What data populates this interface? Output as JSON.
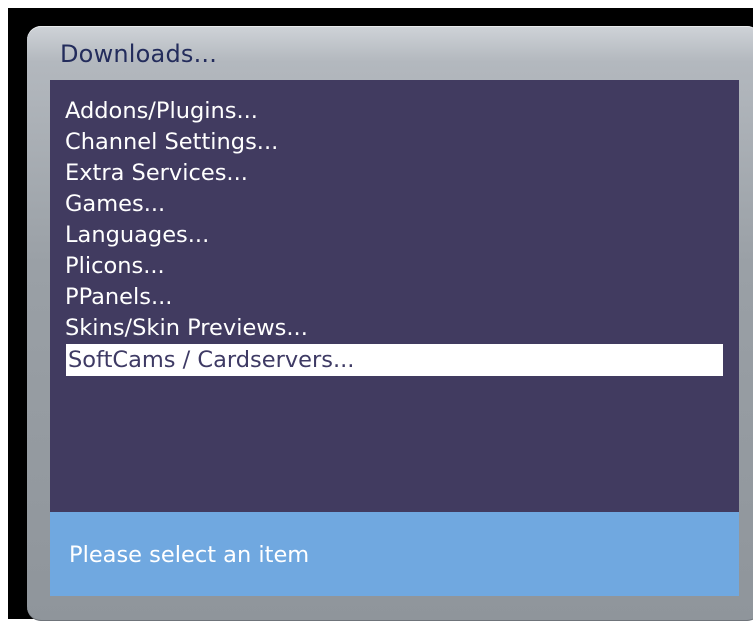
{
  "window": {
    "title": "Downloads..."
  },
  "menu": {
    "items": [
      {
        "label": "Addons/Plugins..."
      },
      {
        "label": "Channel Settings..."
      },
      {
        "label": "Extra Services..."
      },
      {
        "label": "Games..."
      },
      {
        "label": "Languages..."
      },
      {
        "label": "Plicons..."
      },
      {
        "label": "PPanels..."
      },
      {
        "label": "Skins/Skin Previews..."
      },
      {
        "label": "SoftCams / Cardservers...",
        "selected": true
      }
    ]
  },
  "status": {
    "text": "Please select an item"
  },
  "colors": {
    "list_background": "#413b60",
    "status_background": "#70a8e0",
    "selection_background": "#ffffff",
    "window_chrome": "#9aa0a6"
  }
}
